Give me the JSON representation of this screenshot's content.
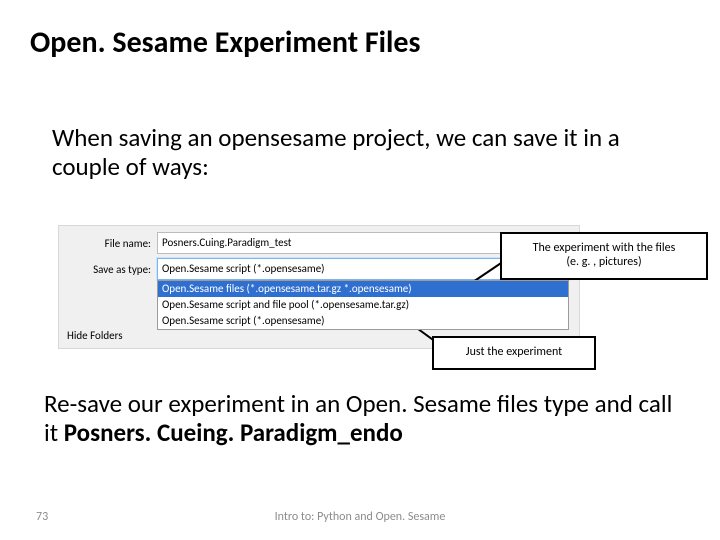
{
  "title": "Open. Sesame Experiment Files",
  "body1": "When saving an opensesame project, we can save it in a couple of ways:",
  "dialog": {
    "filename_label": "File name:",
    "filename_value": "Posners.Cuing.Paradigm_test",
    "type_label": "Save as type:",
    "type_value": "Open.Sesame script (*.opensesame)",
    "options": [
      "Open.Sesame files (*.opensesame.tar.gz *.opensesame)",
      "Open.Sesame script and file pool (*.opensesame.tar.gz)",
      "Open.Sesame script (*.opensesame)"
    ],
    "selected_index": 0,
    "hide_folders": "Hide Folders"
  },
  "callouts": {
    "c1_line1": "The experiment with the files",
    "c1_line2": "(e. g. , pictures)",
    "c2": "Just the experiment"
  },
  "body2_prefix": "Re-save our experiment in an Open. Sesame files type and call it ",
  "body2_bold": "Posners. Cueing. Paradigm_endo",
  "page_number": "73",
  "footer": "Intro to: Python and Open. Sesame"
}
